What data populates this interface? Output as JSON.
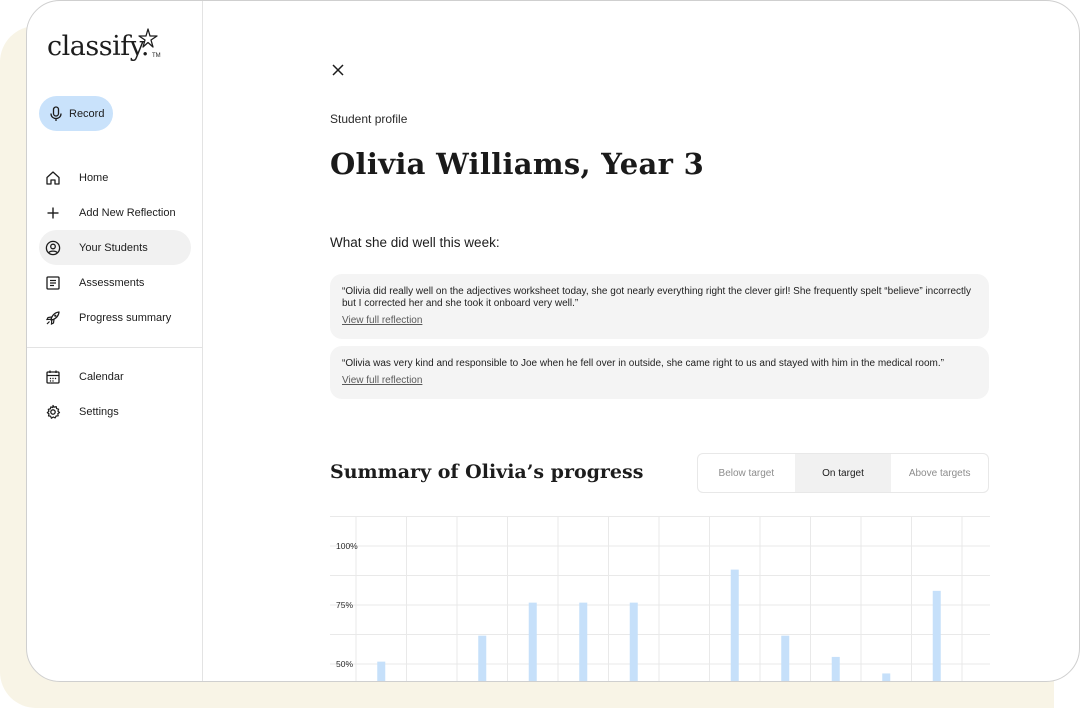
{
  "brand": {
    "name": "classify.",
    "tm": "TM"
  },
  "sidebar": {
    "record_label": "Record",
    "items": [
      {
        "label": "Home",
        "icon": "home-icon"
      },
      {
        "label": "Add New Reflection",
        "icon": "plus-icon"
      },
      {
        "label": "Your Students",
        "icon": "user-circle-icon"
      },
      {
        "label": "Assessments",
        "icon": "document-icon"
      },
      {
        "label": "Progress summary",
        "icon": "rocket-icon"
      }
    ],
    "secondary": [
      {
        "label": "Calendar",
        "icon": "calendar-icon"
      },
      {
        "label": "Settings",
        "icon": "gear-icon"
      }
    ]
  },
  "main": {
    "eyebrow": "Student profile",
    "title": "Olivia Williams, Year 3",
    "section_heading": "What she did well this week:",
    "reflections": [
      {
        "text": "“Olivia did really well on the adjectives worksheet today, she got nearly everything right the clever girl! She frequently spelt “believe” incorrectly but I corrected her and she took it onboard very well.”",
        "link": "View full reflection"
      },
      {
        "text": "“Olivia was very kind and responsible to Joe when he fell over in outside, she came right to us and stayed with him in the medical room.”",
        "link": "View full reflection"
      }
    ],
    "summary_title": "Summary of Olivia’s progress",
    "filters": [
      "Below target",
      "On target",
      "Above targets"
    ],
    "active_filter": "On target"
  },
  "colors": {
    "accent": "#c9e2fb",
    "bar": "#c6e0fa",
    "backdrop": "#f8f4e6"
  },
  "chart_data": {
    "type": "bar",
    "ylim": [
      25,
      110
    ],
    "y_ticks": [
      "100%",
      "75%",
      "50%"
    ],
    "y_tick_values": [
      100,
      75,
      50
    ],
    "values": [
      51,
      62,
      76,
      76,
      76,
      90,
      62,
      53,
      46,
      81
    ],
    "slots": [
      0,
      2,
      3,
      4,
      5,
      7,
      8,
      9,
      10,
      11
    ]
  }
}
